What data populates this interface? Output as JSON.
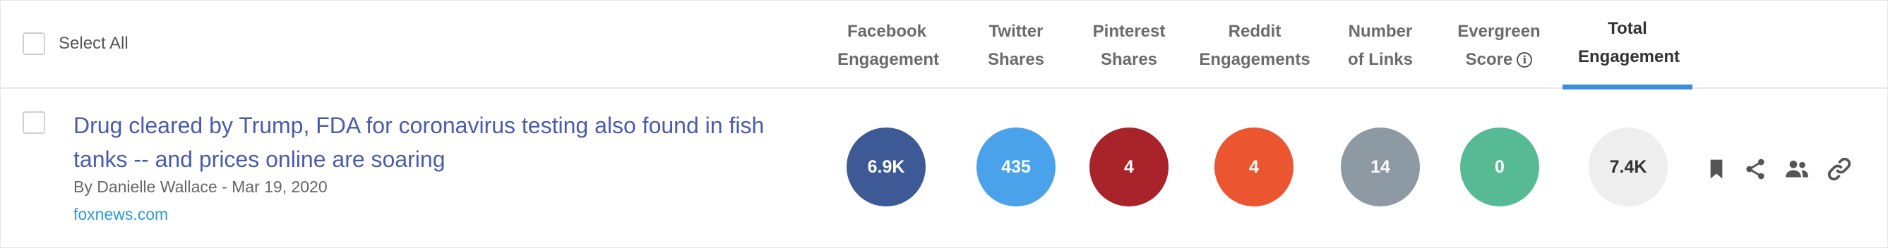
{
  "header": {
    "select_all_label": "Select All",
    "columns": [
      {
        "line1": "Facebook",
        "line2": "Engagement"
      },
      {
        "line1": "Twitter",
        "line2": "Shares"
      },
      {
        "line1": "Pinterest",
        "line2": "Shares"
      },
      {
        "line1": "Reddit",
        "line2": "Engagements"
      },
      {
        "line1": "Number",
        "line2": "of Links"
      },
      {
        "line1": "Evergreen",
        "line2": "Score",
        "info_icon": "info-icon"
      },
      {
        "line1": "Total",
        "line2": "Engagement",
        "active": true
      }
    ]
  },
  "article": {
    "title": "Drug cleared by Trump, FDA for coronavirus testing also found in fish tanks -- and prices online are soaring",
    "byline": "By Danielle Wallace - Mar 19, 2020",
    "domain": "foxnews.com",
    "metrics": {
      "facebook": {
        "value": "6.9K",
        "color": "#3d5a96"
      },
      "twitter": {
        "value": "435",
        "color": "#4aa3ea"
      },
      "pinterest": {
        "value": "4",
        "color": "#a8232a"
      },
      "reddit": {
        "value": "4",
        "color": "#eb5630"
      },
      "links": {
        "value": "14",
        "color": "#8e9aa3"
      },
      "evergreen": {
        "value": "0",
        "color": "#56bb94"
      },
      "total": {
        "value": "7.4K",
        "color": "#eeeeee"
      }
    },
    "actions": [
      "bookmark-icon",
      "share-icon",
      "people-icon",
      "link-icon"
    ]
  },
  "colors": {
    "accent": "#3b8fd9",
    "title_link": "#4a5bab",
    "domain_link": "#2e9ad6"
  }
}
